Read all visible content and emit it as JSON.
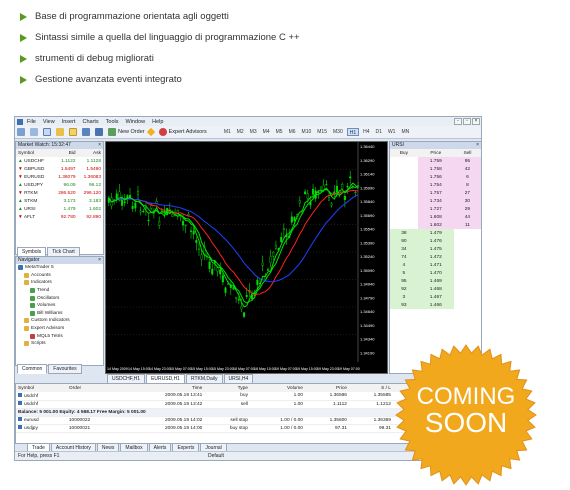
{
  "bullets": [
    "Base di programmazione orientata agli oggetti",
    "Sintassi simile a quella del linguaggio di programmazione C ++",
    "strumenti di debug migliorati",
    "Gestione avanzata eventi integrato"
  ],
  "menu": [
    "File",
    "View",
    "Insert",
    "Charts",
    "Tools",
    "Window",
    "Help"
  ],
  "toolbar": {
    "new_order": "New Order",
    "expert_advisors": "Expert Advisors",
    "timeframes": [
      "M1",
      "M2",
      "M3",
      "M4",
      "M5",
      "M6",
      "M10",
      "M15",
      "M30",
      "H1",
      "H4",
      "D1",
      "W1",
      "MN"
    ],
    "active_tf": "H1"
  },
  "market_watch": {
    "title": "Market Watch: 15:32:47",
    "headers": [
      "Symbol",
      "Bid",
      "Ask"
    ],
    "rows": [
      {
        "dir": "up",
        "symbol": "USDCHF",
        "bid": "1.1122",
        "ask": "1.1128"
      },
      {
        "dir": "dn",
        "symbol": "GBPUSD",
        "bid": "1.5497",
        "ask": "1.5490"
      },
      {
        "dir": "dn",
        "symbol": "EURUSD",
        "bid": "1.36079",
        "ask": "1.36083"
      },
      {
        "dir": "up",
        "symbol": "USDJPY",
        "bid": "96.09",
        "ask": "96.12"
      },
      {
        "dir": "dn",
        "symbol": "RTKM",
        "bid": "286.520",
        "ask": "296.120"
      },
      {
        "dir": "up",
        "symbol": "STKM",
        "bid": "3.173",
        "ask": "3.183"
      },
      {
        "dir": "up",
        "symbol": "URSI",
        "bid": "1.479",
        "ask": "1.602"
      },
      {
        "dir": "dn",
        "symbol": "AFLT",
        "bid": "92.780",
        "ask": "92.890"
      }
    ],
    "tabs": [
      "Symbols",
      "Tick Chart"
    ]
  },
  "navigator": {
    "title": "Navigator",
    "items": [
      "MetaTrader 5",
      "Accounts",
      "Indicators",
      "Trend",
      "Oscillators",
      "Volumes",
      "Bill Williams",
      "Custom Indicators",
      "Expert Advisors",
      "MQL5 Tetris",
      "Scripts"
    ],
    "tabs": [
      "Common",
      "Favourites"
    ]
  },
  "chart": {
    "price_labels": [
      "1.36440",
      "1.36290",
      "1.36140",
      "1.35990",
      "1.35840",
      "1.35690",
      "1.35540",
      "1.35390",
      "1.35240",
      "1.35090",
      "1.34940",
      "1.34790",
      "1.34640",
      "1.34490",
      "1.34340",
      "1.34190"
    ],
    "time_labels": [
      "14 May 2009",
      "14 May 15:00",
      "14 May 23:00",
      "15 May 07:00",
      "15 May 15:00",
      "15 May 23:00",
      "18 May 07:00",
      "18 May 15:00",
      "19 May 07:00",
      "19 May 15:00",
      "19 May 23:00",
      "19 May 07:00"
    ],
    "tabs": [
      "USDCHF,H1",
      "EURUSD,H1",
      "RTKM,Daily",
      "URSI,H4"
    ],
    "active_tab": "EURUSD,H1"
  },
  "dom": {
    "title": "URSI",
    "headers": [
      "Buy",
      "Price",
      "Sell"
    ],
    "sell_rows": [
      {
        "price": "1.759",
        "sell": "95"
      },
      {
        "price": "1.758",
        "sell": "42"
      },
      {
        "price": "1.756",
        "sell": "6"
      },
      {
        "price": "1.754",
        "sell": "8"
      },
      {
        "price": "1.757",
        "sell": "27"
      },
      {
        "price": "1.734",
        "sell": "30"
      },
      {
        "price": "1.727",
        "sell": "29"
      },
      {
        "price": "1.608",
        "sell": "44"
      },
      {
        "price": "1.602",
        "sell": "11"
      }
    ],
    "buy_rows": [
      {
        "buy": "38",
        "price": "1.479"
      },
      {
        "buy": "90",
        "price": "1.476"
      },
      {
        "buy": "34",
        "price": "1.475"
      },
      {
        "buy": "74",
        "price": "1.472"
      },
      {
        "buy": "4",
        "price": "1.471"
      },
      {
        "buy": "5",
        "price": "1.470"
      },
      {
        "buy": "95",
        "price": "1.469"
      },
      {
        "buy": "92",
        "price": "1.468"
      },
      {
        "buy": "3",
        "price": "1.467"
      },
      {
        "buy": "93",
        "price": "1.466"
      }
    ]
  },
  "terminal": {
    "headers": [
      "Symbol",
      "Order",
      "Time",
      "Type",
      "Volume",
      "Price",
      "S / L",
      "T / P",
      "Price"
    ],
    "positions": [
      {
        "symbol": "usdchf",
        "order": "",
        "time": "2009.05.19 13:41",
        "type": "buy",
        "volume": "1.00",
        "price": "1.36586",
        "sl": "1.35585",
        "tp": "1.37389",
        "cur": "1.36079"
      },
      {
        "symbol": "usdchf",
        "order": "",
        "time": "2009.05.19 13:42",
        "type": "sell",
        "volume": "1.00",
        "price": "1.1112",
        "sl": "1.1212",
        "tp": "1.1012",
        "cur": "1.1126"
      }
    ],
    "balance": "Balance: 5 001.00  Equity: 4 568.17  Free Margin: 5 001.00",
    "orders": [
      {
        "symbol": "eurusd",
        "order": "10000022",
        "time": "2009.05.19 14:02",
        "type": "sell stop",
        "volume": "1.00 / 0.00",
        "price": "1.35600",
        "sl": "1.36369",
        "tp": "1.35400",
        "cur": "1.36079"
      },
      {
        "symbol": "usdjpy",
        "order": "10000021",
        "time": "2009.05.19 14:00",
        "type": "buy stop",
        "volume": "1.00 / 0.00",
        "price": "97.31",
        "sl": "99.31",
        "tp": "99.31",
        "cur": "96.12"
      }
    ],
    "tabs": [
      "Trade",
      "Account History",
      "News",
      "Mailbox",
      "Alerts",
      "Experts",
      "Journal"
    ]
  },
  "status": {
    "help": "For Help, press F1",
    "profile": "Default"
  },
  "badge": {
    "line1": "COMING",
    "line2": "SOON"
  },
  "colors": {
    "bullet": "#5a9a1e",
    "badge": "#f2a81d",
    "ma_green": "#00e000",
    "ma_red": "#ff2020",
    "ma_blue": "#2040ff"
  }
}
